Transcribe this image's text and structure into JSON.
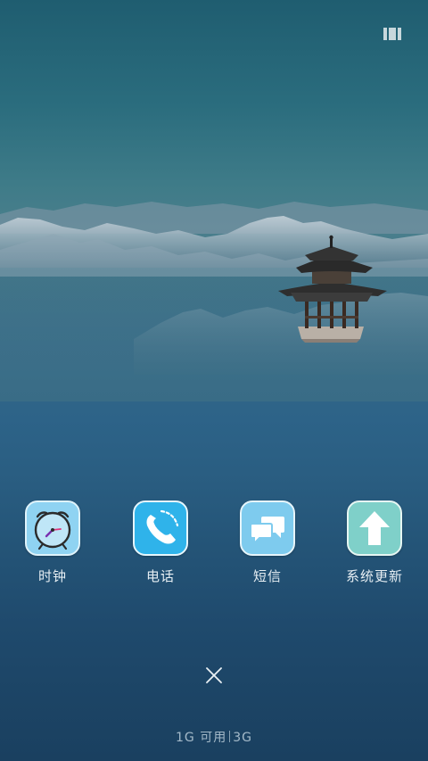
{
  "apps": [
    {
      "label": "时钟",
      "icon": "clock-icon"
    },
    {
      "label": "电话",
      "icon": "phone-icon"
    },
    {
      "label": "短信",
      "icon": "message-icon"
    },
    {
      "label": "系统更新",
      "icon": "upload-arrow-icon"
    }
  ],
  "status": {
    "memory": "1G 可用",
    "network": "3G"
  },
  "colors": {
    "clock_tile": "#8fd3f2",
    "phone_tile": "#2fb3ea",
    "sms_tile": "#7ecbee",
    "update_tile": "#7fd0c9"
  }
}
